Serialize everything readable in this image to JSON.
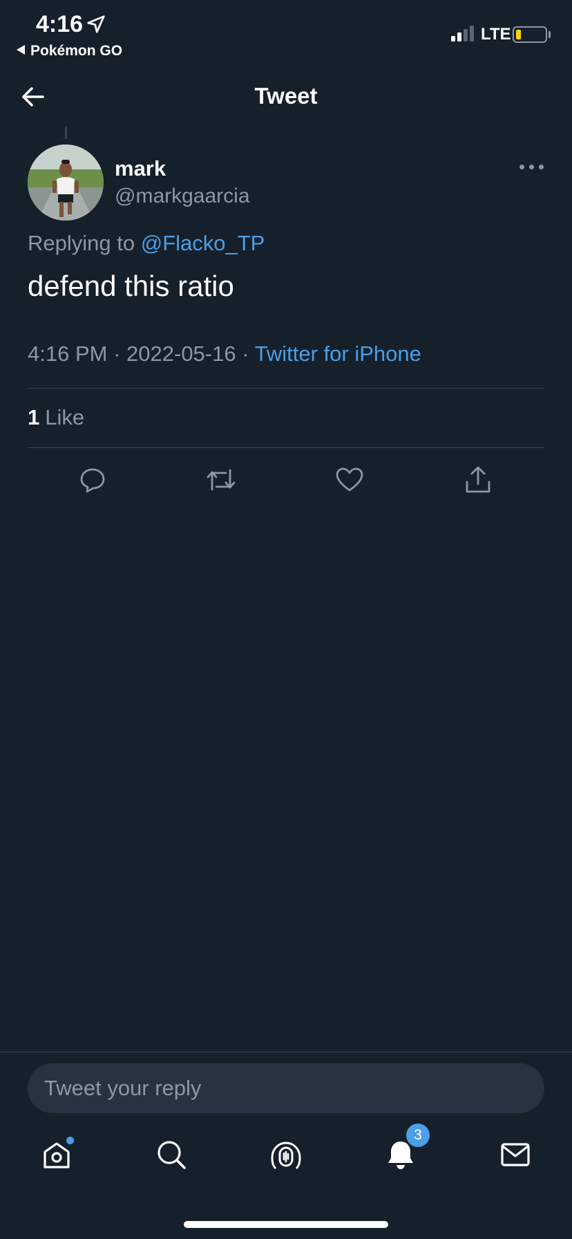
{
  "status_bar": {
    "time": "4:16",
    "back_app": "Pokémon GO",
    "network": "LTE",
    "location_icon": "location-arrow-icon",
    "signal_icon": "signal-bars-icon",
    "battery_icon": "battery-icon",
    "battery_color": "#ffd60a"
  },
  "header": {
    "title": "Tweet",
    "back_icon": "back-arrow-icon"
  },
  "tweet": {
    "author_name": "mark",
    "author_handle": "@markgaarcia",
    "avatar_icon": "avatar-photo",
    "more_icon": "more-options-icon",
    "replying_prefix": "Replying to",
    "replying_to": "@Flacko_TP",
    "text": "defend this ratio",
    "time": "4:16 PM",
    "date": "2022-05-16",
    "separator": "·",
    "source": "Twitter for iPhone",
    "like_count": "1",
    "like_label": "Like"
  },
  "actions": [
    {
      "name": "reply-icon"
    },
    {
      "name": "retweet-icon"
    },
    {
      "name": "like-icon"
    },
    {
      "name": "share-icon"
    }
  ],
  "reply_bar": {
    "placeholder": "Tweet your reply"
  },
  "tabbar": {
    "items": [
      {
        "name": "home-icon"
      },
      {
        "name": "search-icon"
      },
      {
        "name": "spaces-icon"
      },
      {
        "name": "notifications-icon"
      },
      {
        "name": "messages-icon"
      }
    ],
    "notifications_badge": "3"
  },
  "colors": {
    "background": "#15202b",
    "accent": "#4a9fe8",
    "secondary_text": "#8b98a5",
    "divider": "#38444d"
  }
}
